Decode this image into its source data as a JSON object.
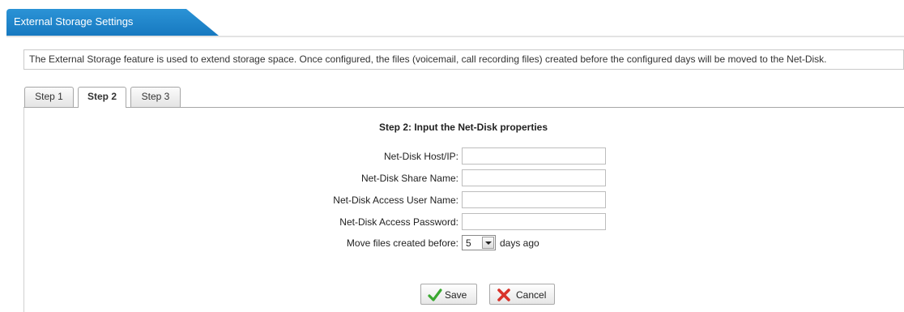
{
  "header": {
    "title": "External Storage Settings"
  },
  "notice": "The External Storage feature is used to extend storage space. Once configured, the files (voicemail, call recording files) created before the configured days will be moved to the Net-Disk.",
  "tabs": [
    {
      "label": "Step 1",
      "active": false
    },
    {
      "label": "Step 2",
      "active": true
    },
    {
      "label": "Step 3",
      "active": false
    }
  ],
  "form": {
    "title": "Step 2: Input the Net-Disk properties",
    "fields": [
      {
        "label": "Net-Disk Host/IP:",
        "value": ""
      },
      {
        "label": "Net-Disk Share Name:",
        "value": ""
      },
      {
        "label": "Net-Disk Access User Name:",
        "value": ""
      },
      {
        "label": "Net-Disk Access Password:",
        "value": ""
      }
    ],
    "move_files": {
      "label": "Move files created before:",
      "value": "5",
      "suffix": "days ago"
    }
  },
  "buttons": {
    "save": "Save",
    "cancel": "Cancel"
  },
  "colors": {
    "header_blue": "#1f86cb",
    "save_icon": "#3aa830",
    "cancel_icon": "#d9342b"
  }
}
